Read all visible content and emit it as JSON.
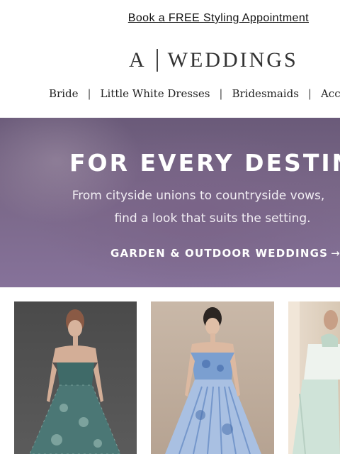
{
  "promo": {
    "link_text": "Book a FREE Styling Appointment"
  },
  "brand": {
    "logo_mark": "A",
    "logo_word": "WEDDINGS"
  },
  "nav": {
    "items": [
      {
        "label": "Bride"
      },
      {
        "label": "Little White Dresses"
      },
      {
        "label": "Bridesmaids"
      },
      {
        "label": "Acces"
      }
    ],
    "separator": "|"
  },
  "hero": {
    "title": "For Every Destinatio",
    "subtitle_line1": "From cityside unions to countryside vows,",
    "subtitle_line2": "find a look that suits the setting.",
    "cta_label": "Garden & Outdoor Weddings",
    "cta_arrow": "→"
  },
  "products": [
    {
      "name": "green-floral-strapless-gown",
      "icon": "dress-image"
    },
    {
      "name": "blue-floral-pleated-gown",
      "icon": "dress-image"
    },
    {
      "name": "mint-ruffle-gown",
      "icon": "dress-image"
    }
  ],
  "colors": {
    "hero_bg": "#75638a",
    "text": "#222222"
  }
}
